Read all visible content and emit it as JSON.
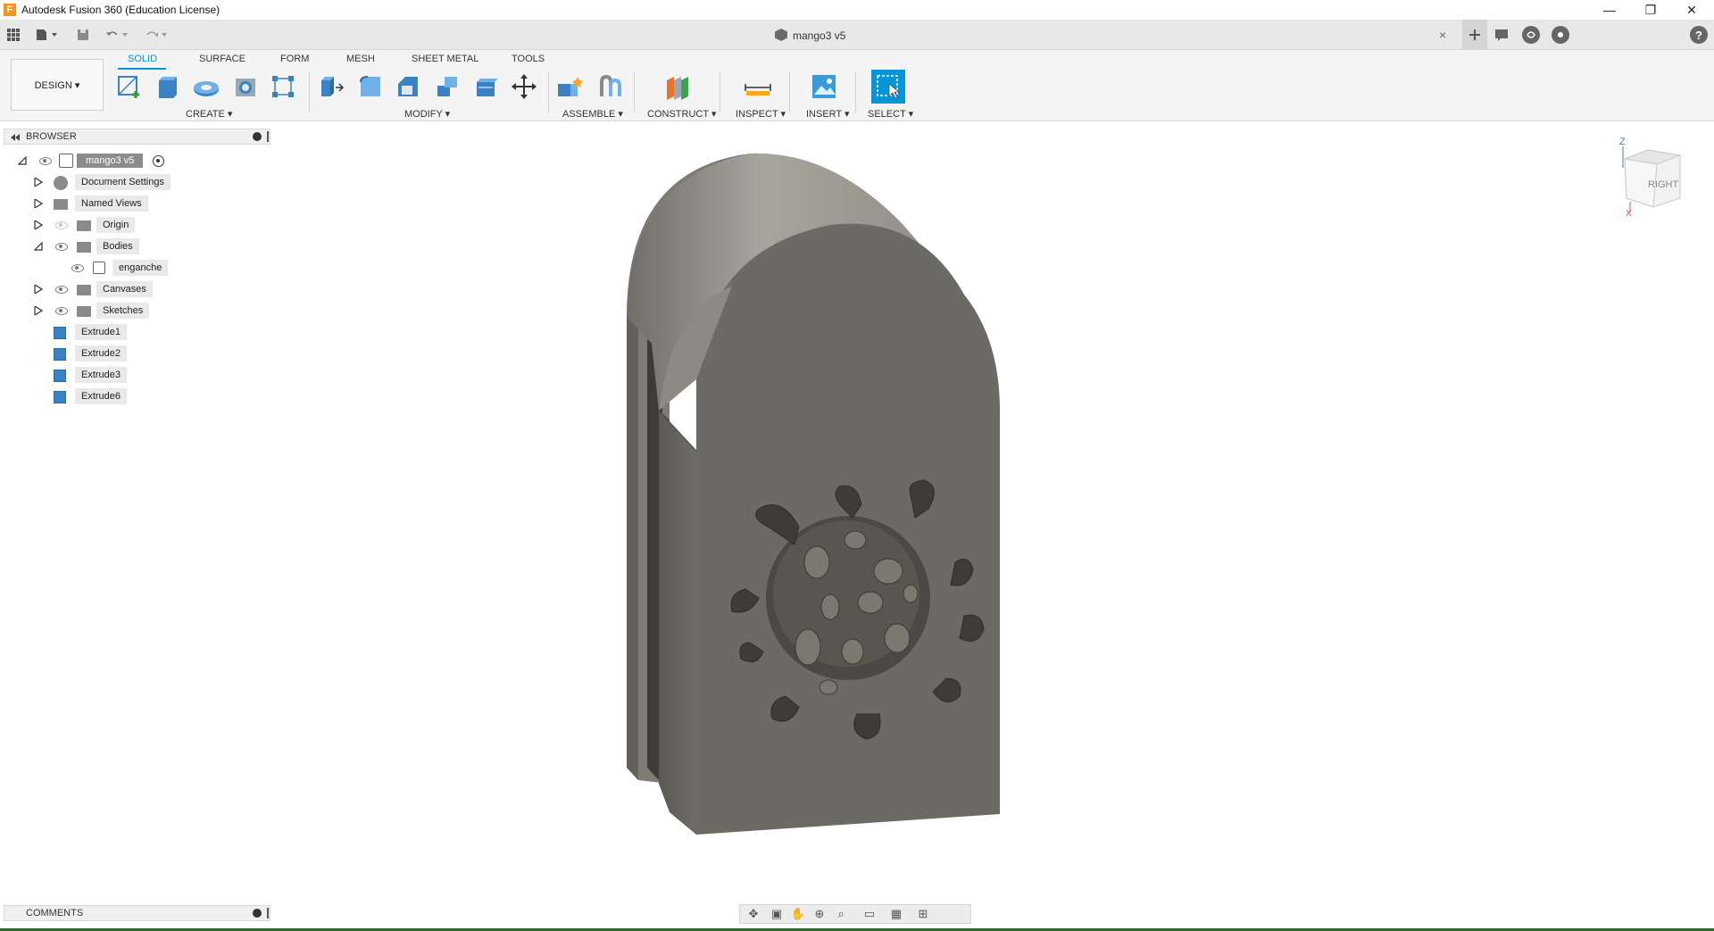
{
  "window": {
    "title": "Autodesk Fusion 360 (Education License)",
    "logo_letter": "F",
    "controls": [
      "—",
      "❐",
      "✕"
    ]
  },
  "document_tab": {
    "label": "mango3 v5",
    "close": "×"
  },
  "toolbar": {
    "tabs": [
      "SOLID",
      "SURFACE",
      "FORM",
      "MESH",
      "SHEET METAL",
      "TOOLS"
    ],
    "active_tab": "SOLID",
    "workspace": "DESIGN ▾",
    "groups": {
      "create": "CREATE ▾",
      "modify": "MODIFY ▾",
      "assemble": "ASSEMBLE ▾",
      "construct": "CONSTRUCT ▾",
      "inspect": "INSPECT ▾",
      "insert": "INSERT ▾",
      "select": "SELECT ▾"
    }
  },
  "browser": {
    "title": "BROWSER",
    "root": "mango3 v5",
    "items": [
      {
        "label": "Document Settings",
        "icon": "gear-icon"
      },
      {
        "label": "Named Views",
        "icon": "folder-icon"
      },
      {
        "label": "Origin",
        "icon": "folder-icon"
      },
      {
        "label": "Bodies",
        "icon": "folder-icon"
      },
      {
        "label": "enganche",
        "icon": "body-icon"
      },
      {
        "label": "Canvases",
        "icon": "folder-icon"
      },
      {
        "label": "Sketches",
        "icon": "folder-icon"
      },
      {
        "label": "Extrude1",
        "icon": "extrude-icon"
      },
      {
        "label": "Extrude2",
        "icon": "extrude-icon"
      },
      {
        "label": "Extrude3",
        "icon": "extrude-icon"
      },
      {
        "label": "Extrude6",
        "icon": "extrude-icon"
      }
    ]
  },
  "comments": {
    "title": "COMMENTS"
  },
  "viewcube": {
    "face": "RIGHT",
    "axis_z": "Z",
    "axis_x": "X"
  },
  "colors": {
    "accent": "#0696d7",
    "model": "#6b6b66",
    "statusbar": "#2d6a2d"
  }
}
